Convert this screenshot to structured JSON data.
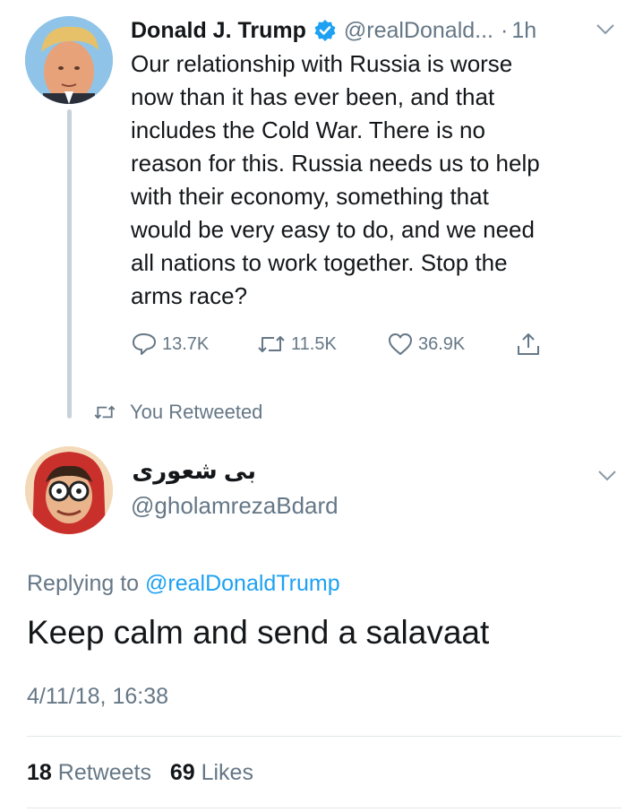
{
  "parent_tweet": {
    "author_name": "Donald J. Trump",
    "handle": "@realDonald...",
    "separator": "·",
    "time_ago": "1h",
    "text": "Our relationship with Russia is worse\nnow than it has ever been, and that\nincludes the Cold War. There is no\nreason for this. Russia needs us to help\nwith their economy, something that\nwould be very easy to do, and we need\nall nations to work together. Stop the\narms race?",
    "reply_count": "13.7K",
    "retweet_count": "11.5K",
    "like_count": "36.9K",
    "icons": {
      "verified": "verified-badge-icon",
      "caret": "chevron-down-icon",
      "reply": "reply-icon",
      "retweet": "retweet-icon",
      "like": "heart-icon",
      "share": "share-icon"
    }
  },
  "retweet_notice": {
    "label": "You Retweeted"
  },
  "reply_tweet": {
    "author_name": "بی شعوری",
    "handle": "@gholamrezaBdard",
    "replying_prefix": "Replying to",
    "replying_to": "@realDonaldTrump",
    "text": "Keep calm and send a salavaat",
    "timestamp": "4/11/18, 16:38",
    "retweets_count": "18",
    "retweets_label": "Retweets",
    "likes_count": "69",
    "likes_label": "Likes"
  },
  "colors": {
    "text": "#14171a",
    "secondary": "#657786",
    "link": "#1da1f2",
    "thread_line": "#c8d2da",
    "divider": "#e1e8ed"
  }
}
